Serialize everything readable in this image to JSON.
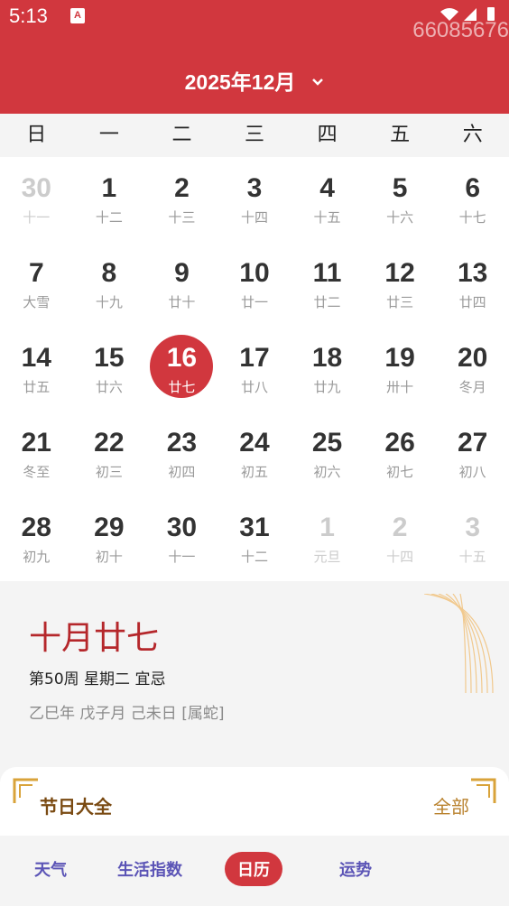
{
  "status": {
    "time": "5:13",
    "app_badge": "A",
    "icons": "▾◢▮"
  },
  "watermark": "66085676",
  "header": {
    "month_title": "2025年12月",
    "chevron": "⌄"
  },
  "weekdays": [
    "日",
    "一",
    "二",
    "三",
    "四",
    "五",
    "六"
  ],
  "days": [
    {
      "n": "30",
      "l": "十一",
      "faded": true
    },
    {
      "n": "1",
      "l": "十二"
    },
    {
      "n": "2",
      "l": "十三"
    },
    {
      "n": "3",
      "l": "十四"
    },
    {
      "n": "4",
      "l": "十五"
    },
    {
      "n": "5",
      "l": "十六"
    },
    {
      "n": "6",
      "l": "十七"
    },
    {
      "n": "7",
      "l": "大雪"
    },
    {
      "n": "8",
      "l": "十九"
    },
    {
      "n": "9",
      "l": "廿十"
    },
    {
      "n": "10",
      "l": "廿一"
    },
    {
      "n": "11",
      "l": "廿二"
    },
    {
      "n": "12",
      "l": "廿三"
    },
    {
      "n": "13",
      "l": "廿四"
    },
    {
      "n": "14",
      "l": "廿五"
    },
    {
      "n": "15",
      "l": "廿六"
    },
    {
      "n": "16",
      "l": "廿七",
      "selected": true
    },
    {
      "n": "17",
      "l": "廿八"
    },
    {
      "n": "18",
      "l": "廿九"
    },
    {
      "n": "19",
      "l": "卅十"
    },
    {
      "n": "20",
      "l": "冬月"
    },
    {
      "n": "21",
      "l": "冬至"
    },
    {
      "n": "22",
      "l": "初三"
    },
    {
      "n": "23",
      "l": "初四"
    },
    {
      "n": "24",
      "l": "初五"
    },
    {
      "n": "25",
      "l": "初六"
    },
    {
      "n": "26",
      "l": "初七"
    },
    {
      "n": "27",
      "l": "初八"
    },
    {
      "n": "28",
      "l": "初九"
    },
    {
      "n": "29",
      "l": "初十"
    },
    {
      "n": "30",
      "l": "十一"
    },
    {
      "n": "31",
      "l": "十二"
    },
    {
      "n": "1",
      "l": "元旦",
      "faded": true
    },
    {
      "n": "2",
      "l": "十四",
      "faded": true
    },
    {
      "n": "3",
      "l": "十五",
      "faded": true
    }
  ],
  "info": {
    "lunar_date": "十月廿七",
    "week_line": "第50周 星期二 宜忌",
    "ganzhi": "乙巳年 戊子月 己未日 [属蛇]"
  },
  "festival": {
    "title": "节日大全",
    "all_label": "全部"
  },
  "tabs": [
    {
      "label": "天气",
      "active": false
    },
    {
      "label": "生活指数",
      "active": false
    },
    {
      "label": "日历",
      "active": true
    },
    {
      "label": "运势",
      "active": false
    }
  ],
  "colors": {
    "primary_red": "#d1373e",
    "accent_purple": "#5b54b6",
    "gold": "#d9a33a"
  }
}
